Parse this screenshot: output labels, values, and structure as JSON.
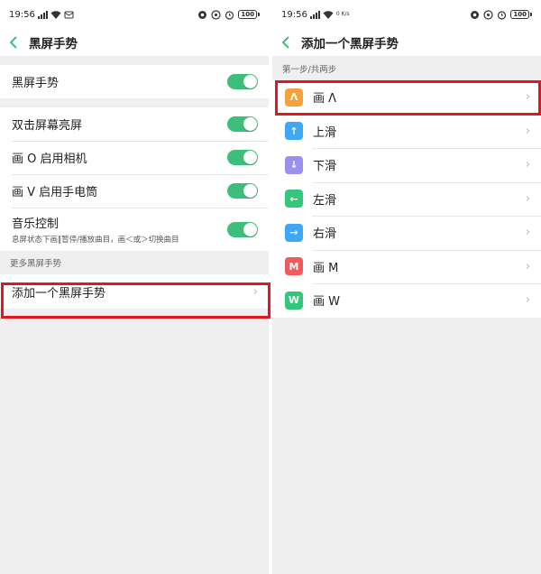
{
  "colors": {
    "accent": "#3dbf7b",
    "highlight": "#e5141e",
    "icon_orange": "#f5a13c",
    "icon_blue": "#3fa8f4",
    "icon_purple": "#9b8ff0",
    "icon_green": "#34c77b",
    "icon_red": "#f05a5a"
  },
  "left": {
    "status": {
      "time": "19:56",
      "battery": "100"
    },
    "header": {
      "title": "黑屏手势"
    },
    "main_toggle": {
      "label": "黑屏手势",
      "on": true
    },
    "settings": [
      {
        "label": "双击屏幕亮屏",
        "on": true
      },
      {
        "label": "画 O 启用相机",
        "on": true
      },
      {
        "label": "画 V 启用手电筒",
        "on": true
      },
      {
        "label": "音乐控制",
        "sub": "息屏状态下画‖暂停/播放曲目，画＜或＞切换曲目",
        "on": true
      }
    ],
    "more_section": {
      "label": "更多黑屏手势"
    },
    "add_gesture": {
      "label": "添加一个黑屏手势"
    }
  },
  "right": {
    "status": {
      "time": "19:56",
      "battery": "100",
      "netspeed": "0 K/s"
    },
    "header": {
      "title": "添加一个黑屏手势"
    },
    "step_label": "第一步/共两步",
    "gestures": [
      {
        "label": "画 Λ",
        "icon": "Λ",
        "icon_name": "draw-caret-icon",
        "color": "#f5a13c"
      },
      {
        "label": "上滑",
        "icon": "↑",
        "icon_name": "arrow-up-icon",
        "color": "#3fa8f4"
      },
      {
        "label": "下滑",
        "icon": "↓",
        "icon_name": "arrow-down-icon",
        "color": "#9b8ff0"
      },
      {
        "label": "左滑",
        "icon": "←",
        "icon_name": "arrow-left-icon",
        "color": "#34c77b"
      },
      {
        "label": "右滑",
        "icon": "→",
        "icon_name": "arrow-right-icon",
        "color": "#3fa8f4"
      },
      {
        "label": "画 M",
        "icon": "M",
        "icon_name": "letter-m-icon",
        "color": "#f05a5a"
      },
      {
        "label": "画 W",
        "icon": "W",
        "icon_name": "letter-w-icon",
        "color": "#34c77b"
      }
    ]
  }
}
